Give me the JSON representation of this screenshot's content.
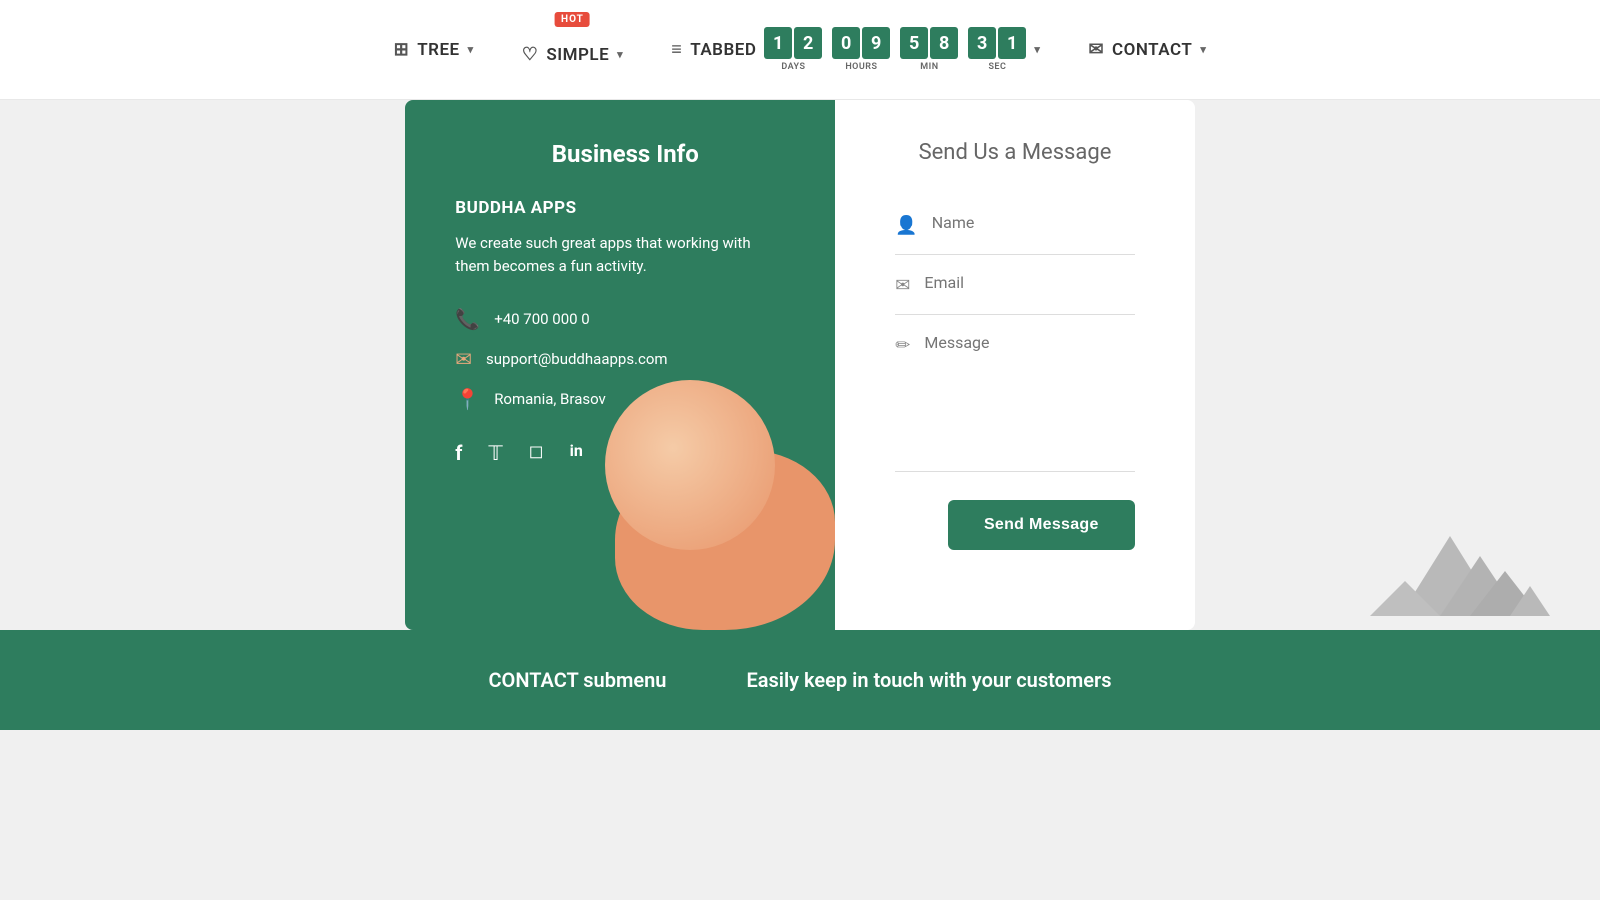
{
  "nav": {
    "tree_label": "TREE",
    "simple_label": "SIMPLE",
    "tabbed_label": "TABBED",
    "contact_label": "CONTACT",
    "hot_badge": "HOT",
    "countdown": {
      "days": [
        "1",
        "2"
      ],
      "hours": [
        "0",
        "9"
      ],
      "minutes": [
        "5",
        "8"
      ],
      "seconds": [
        "3",
        "1"
      ],
      "days_label": "DAYS",
      "hours_label": "HOURS",
      "min_label": "MIN",
      "sec_label": "SEC"
    }
  },
  "business": {
    "section_title": "Business Info",
    "company_name": "BUDDHA APPS",
    "description": "We create such great apps that working with them becomes a fun activity.",
    "phone": "+40 700 000 0",
    "email": "support@buddhaapps.com",
    "location": "Romania, Brasov"
  },
  "form": {
    "title": "Send Us a Message",
    "name_placeholder": "Name",
    "email_placeholder": "Email",
    "message_placeholder": "Message",
    "send_label": "Send Message"
  },
  "footer": {
    "left_text": "CONTACT submenu",
    "right_text": "Easily keep in touch with your customers"
  }
}
